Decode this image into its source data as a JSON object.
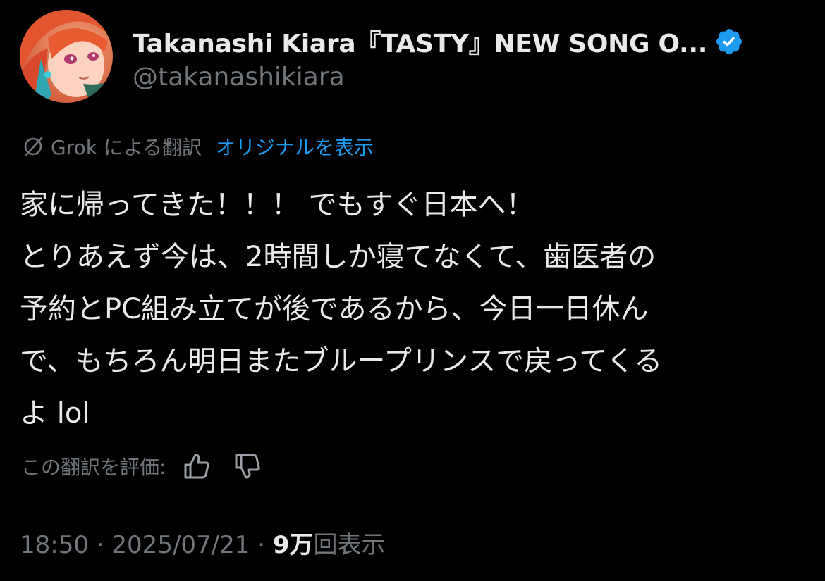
{
  "author": {
    "display_name": "Takanashi Kiara『TASTY』NEW SONG O...",
    "handle": "@takanashikiara",
    "verified": true
  },
  "translation": {
    "source_label": "Grok による翻訳",
    "show_original_label": "オリジナルを表示"
  },
  "tweet": {
    "lines": [
      "家に帰ってきた！！！ でもすぐ日本へ！",
      "とりあえず今は、2時間しか寝てなくて、歯医者の",
      "予約とPC組み立てが後であるから、今日一日休ん",
      "で、もちろん明日またブループリンスで戻ってくる",
      "よ lol"
    ]
  },
  "rate": {
    "label": "この翻訳を評価:"
  },
  "meta": {
    "time": "18:50",
    "separator": " · ",
    "date": "2025/07/21",
    "views_count": "9万",
    "views_label": "回表示"
  },
  "colors": {
    "background": "#000000",
    "text_primary": "#e7e9ea",
    "text_secondary": "#71767b",
    "accent": "#1d9bf0"
  }
}
